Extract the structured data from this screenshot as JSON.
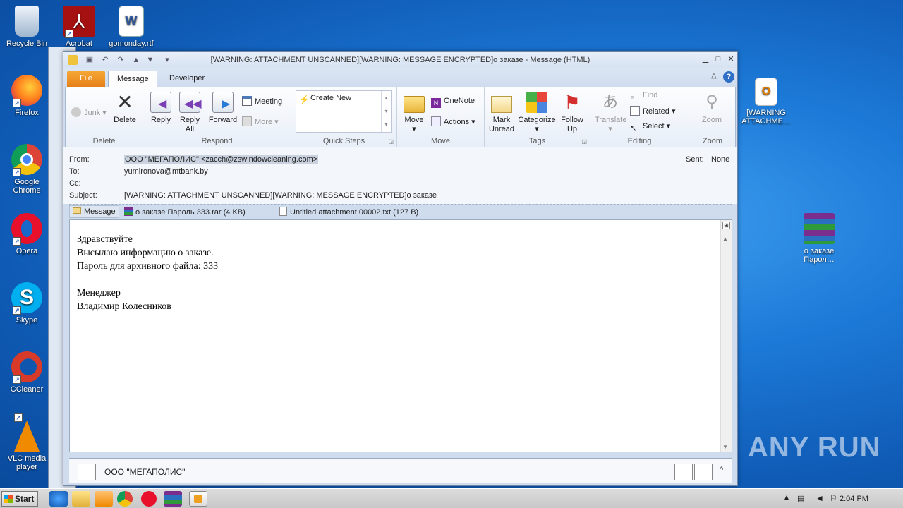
{
  "desktop": {
    "left_icons": [
      {
        "label": "Recycle Bin",
        "icon": "recycle-bin-icon"
      },
      {
        "label": "Firefox",
        "icon": "firefox-icon"
      },
      {
        "label": "Google Chrome",
        "icon": "chrome-icon"
      },
      {
        "label": "Opera",
        "icon": "opera-icon"
      },
      {
        "label": "Skype",
        "icon": "skype-icon"
      },
      {
        "label": "CCleaner",
        "icon": "ccleaner-icon"
      },
      {
        "label": "VLC media player",
        "icon": "vlc-icon"
      }
    ],
    "top_icons": [
      {
        "label": "Acrobat",
        "icon": "acrobat-icon"
      },
      {
        "label": "gomonday.rtf",
        "icon": "word-doc-icon"
      }
    ],
    "right_icons": [
      {
        "label": "[WARNING ATTACHME…",
        "icon": "outlook-msg-icon"
      },
      {
        "label": "о заказе Парол…",
        "icon": "winrar-archive-icon"
      }
    ],
    "watermark": "ANY RUN"
  },
  "window": {
    "title": "[WARNING: ATTACHMENT UNSCANNED][WARNING: MESSAGE ENCRYPTED]о заказе  -  Message (HTML)",
    "tabs": [
      "File",
      "Message",
      "Developer"
    ]
  },
  "ribbon": {
    "delete": {
      "junk": "Junk",
      "delete": "Delete",
      "label": "Delete"
    },
    "respond": {
      "reply": "Reply",
      "reply_all": "Reply All",
      "forward": "Forward",
      "meeting": "Meeting",
      "more": "More",
      "label": "Respond"
    },
    "quick_steps": {
      "create_new": "Create New",
      "label": "Quick Steps"
    },
    "move": {
      "move": "Move",
      "onenote": "OneNote",
      "actions": "Actions",
      "label": "Move"
    },
    "tags": {
      "mark_unread": "Mark Unread",
      "categorize": "Categorize",
      "follow_up": "Follow Up",
      "label": "Tags"
    },
    "editing": {
      "translate": "Translate",
      "find": "Find",
      "related": "Related",
      "select": "Select",
      "label": "Editing"
    },
    "zoom": {
      "zoom": "Zoom",
      "label": "Zoom"
    }
  },
  "message": {
    "from_label": "From:",
    "from": "ООО \"МЕГАПОЛИС\" <zacch@zswindowcleaning.com>",
    "to_label": "To:",
    "to": "yumironova@mtbank.by",
    "cc_label": "Cc:",
    "cc": "",
    "subject_label": "Subject:",
    "subject": "[WARNING: ATTACHMENT UNSCANNED][WARNING: MESSAGE ENCRYPTED]о заказе",
    "sent_label": "Sent:",
    "sent": "None",
    "attachments": [
      {
        "label": "Message"
      },
      {
        "label": "о заказе Пароль 333.rar (4 KB)"
      },
      {
        "label": "Untitled attachment 00002.txt (127 B)"
      }
    ],
    "body_lines": [
      "Здравствуйте",
      "Высылаю информацию о заказе.",
      "Пароль для архивного файла: 333",
      "",
      "Менеджер",
      "Владимир Колесников"
    ],
    "people_pane_name": "ООО \"МЕГАПОЛИС\""
  },
  "taskbar": {
    "start": "Start",
    "time": "2:04 PM"
  }
}
